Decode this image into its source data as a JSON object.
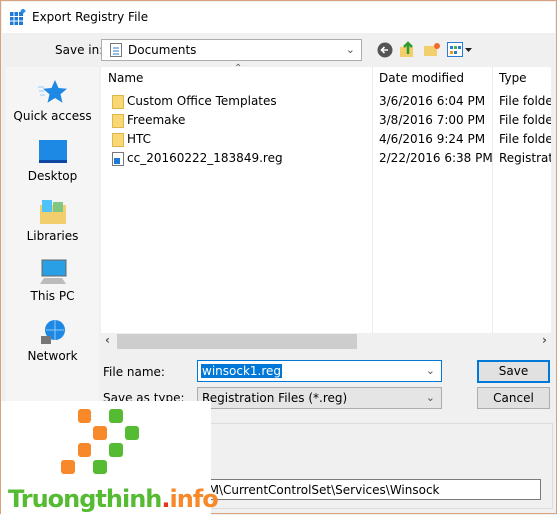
{
  "window": {
    "title": "Export Registry File",
    "border_color": "#d9a27a"
  },
  "save_in": {
    "label": "Save in:",
    "value": "Documents"
  },
  "toolbar": {
    "icons": [
      "back-icon",
      "up-folder-icon",
      "new-folder-icon",
      "view-menu-icon"
    ]
  },
  "sidebar": {
    "items": [
      {
        "label": "Quick access",
        "icon": "star-icon"
      },
      {
        "label": "Desktop",
        "icon": "desktop-icon"
      },
      {
        "label": "Libraries",
        "icon": "libraries-icon"
      },
      {
        "label": "This PC",
        "icon": "computer-icon"
      },
      {
        "label": "Network",
        "icon": "network-icon"
      }
    ]
  },
  "list": {
    "columns": [
      "Name",
      "Date modified",
      "Type"
    ],
    "rows": [
      {
        "name": "Custom Office Templates",
        "date": "3/6/2016 6:04 PM",
        "type": "File folder",
        "icon": "folder"
      },
      {
        "name": "Freemake",
        "date": "3/8/2016 7:00 PM",
        "type": "File folder",
        "icon": "folder"
      },
      {
        "name": "HTC",
        "date": "4/6/2016 9:24 PM",
        "type": "File folder",
        "icon": "folder"
      },
      {
        "name": "cc_20160222_183849.reg",
        "date": "2/22/2016 6:38 PM",
        "type": "Registration",
        "icon": "reg-file"
      }
    ]
  },
  "file_name": {
    "label": "File name:",
    "value": "winsock1.reg"
  },
  "save_type": {
    "label": "Save as type:",
    "value": "Registration Files (*.reg)"
  },
  "buttons": {
    "save": "Save",
    "cancel": "Cancel"
  },
  "export_range": {
    "branch_value": "EM\\CurrentControlSet\\Services\\Winsock"
  },
  "watermark": {
    "text_main": "Truongthinh",
    "text_dot": ".",
    "text_suffix": "info",
    "green": "#55bb33",
    "orange": "#f7892a",
    "red": "#e53322"
  }
}
